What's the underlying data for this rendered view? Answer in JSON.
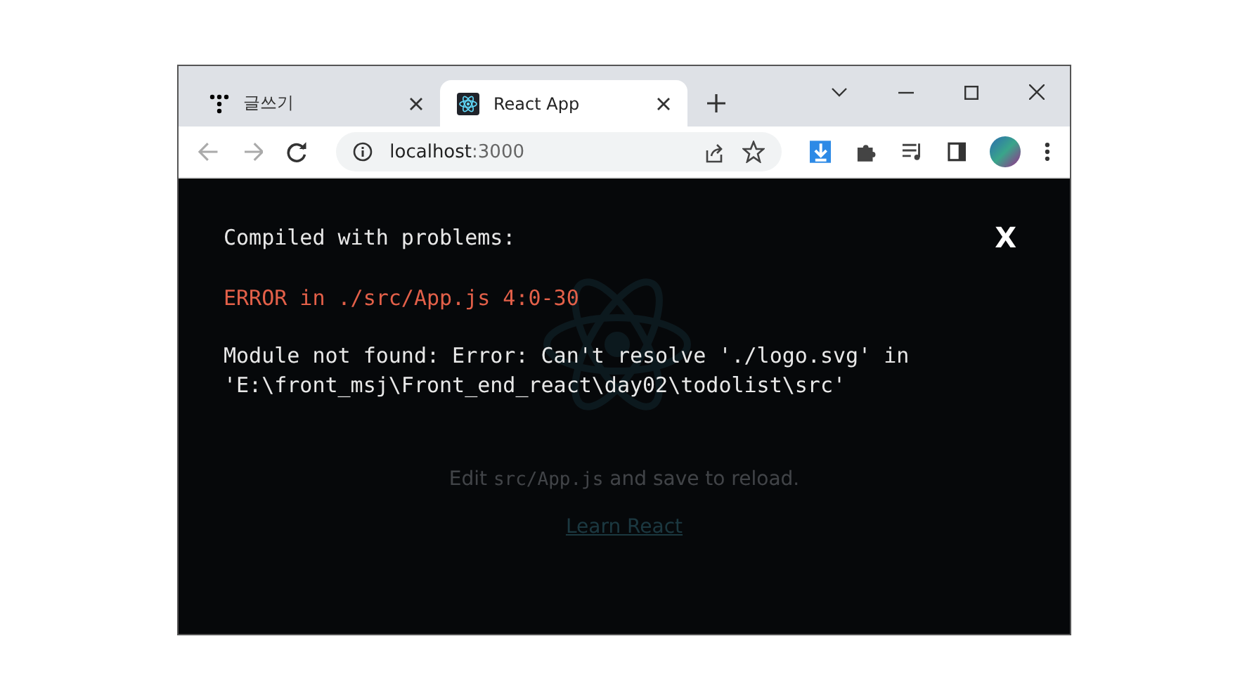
{
  "tabs": [
    {
      "title": "글쓰기",
      "selected": false,
      "kind": "dots"
    },
    {
      "title": "React App",
      "selected": true,
      "kind": "react"
    }
  ],
  "address": {
    "host": "localhost",
    "port": ":3000"
  },
  "page": {
    "edit_before": "Edit ",
    "edit_code": "src/App.js",
    "edit_after": " and save to reload.",
    "link": "Learn React"
  },
  "overlay": {
    "title": "Compiled with problems:",
    "close": "X",
    "error": "ERROR in ./src/App.js 4:0-30",
    "message": "Module not found: Error: Can't resolve './logo.svg' in 'E:\\front_msj\\Front_end_react\\day02\\todolist\\src'"
  }
}
